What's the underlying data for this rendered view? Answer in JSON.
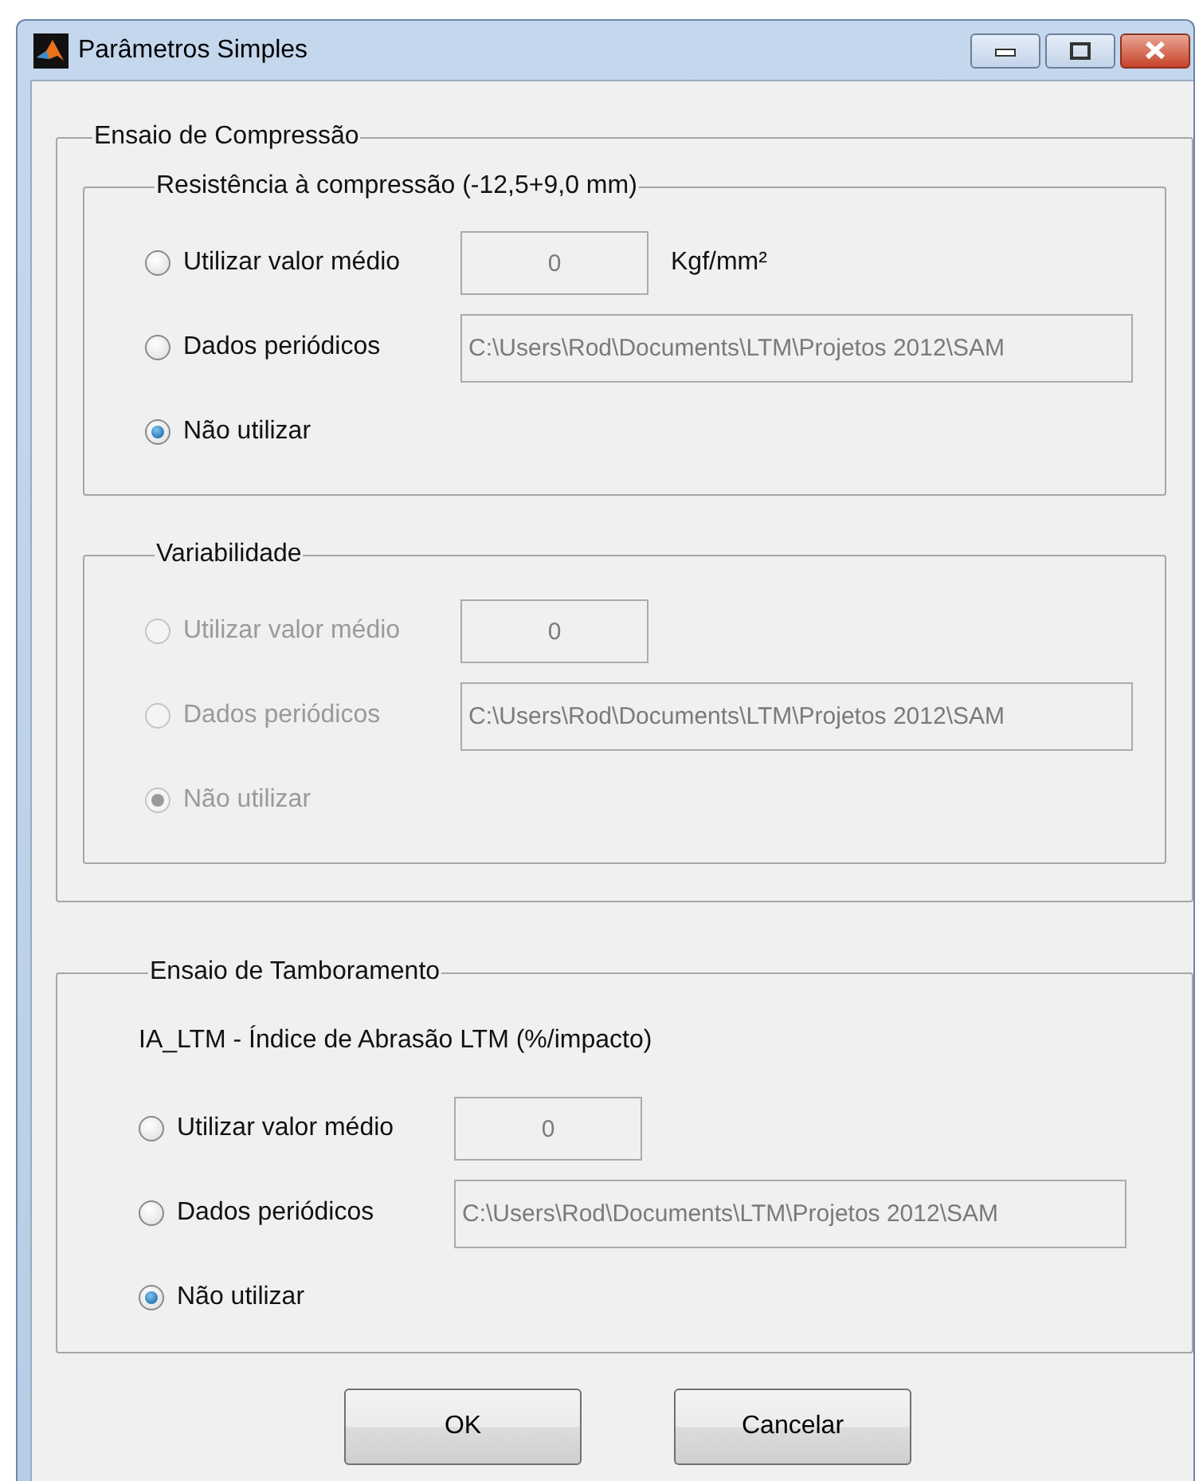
{
  "window": {
    "title": "Parâmetros Simples"
  },
  "sections": [
    {
      "title": "Ensaio de Compressão",
      "groups": [
        {
          "title": "Resistência à compressão (-12,5+9,0 mm)",
          "disabled": false,
          "options": [
            {
              "kind": "value",
              "label": "Utilizar valor médio",
              "selected": false,
              "value": "0",
              "unit": "Kgf/mm²"
            },
            {
              "kind": "file",
              "label": "Dados periódicos",
              "selected": false,
              "value": "C:\\Users\\Rod\\Documents\\LTM\\Projetos 2012\\SAM"
            },
            {
              "kind": "none",
              "label": "Não utilizar",
              "selected": true
            }
          ]
        },
        {
          "title": "Variabilidade",
          "disabled": true,
          "options": [
            {
              "kind": "value",
              "label": "Utilizar valor médio",
              "selected": false,
              "value": "0"
            },
            {
              "kind": "file",
              "label": "Dados periódicos",
              "selected": false,
              "value": "C:\\Users\\Rod\\Documents\\LTM\\Projetos 2012\\SAM"
            },
            {
              "kind": "none",
              "label": "Não utilizar",
              "selected": true
            }
          ]
        }
      ]
    },
    {
      "title": "Ensaio de Tamboramento",
      "caption": "IA_LTM - Índice de Abrasão LTM (%/impacto)",
      "disabled": false,
      "options": [
        {
          "kind": "value",
          "label": "Utilizar valor médio",
          "selected": false,
          "value": "0"
        },
        {
          "kind": "file",
          "label": "Dados periódicos",
          "selected": false,
          "value": "C:\\Users\\Rod\\Documents\\LTM\\Projetos 2012\\SAM"
        },
        {
          "kind": "none",
          "label": "Não utilizar",
          "selected": true
        }
      ]
    }
  ],
  "buttons": [
    "OK",
    "Cancelar"
  ]
}
